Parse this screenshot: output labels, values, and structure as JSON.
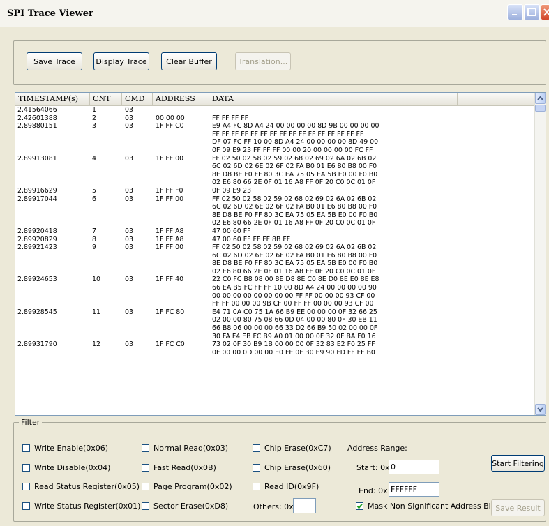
{
  "window": {
    "title": "SPI Trace Viewer"
  },
  "toolbar": {
    "save_trace": "Save Trace",
    "display_trace": "Display Trace",
    "clear_buffer": "Clear Buffer",
    "translation": "Translation..."
  },
  "columns": [
    "TIMESTAMP(s)",
    "CNT",
    "CMD",
    "ADDRESS",
    "DATA"
  ],
  "rows": [
    {
      "ts": "2.41564066",
      "cnt": "1",
      "cmd": "03",
      "addr": "",
      "data": [
        ""
      ]
    },
    {
      "ts": "2.42601388",
      "cnt": "2",
      "cmd": "03",
      "addr": "00 00 00",
      "data": [
        "FF FF FF FF"
      ]
    },
    {
      "ts": "2.89880151",
      "cnt": "3",
      "cmd": "03",
      "addr": "1F FF C0",
      "data": [
        "E9 A4 FC 8D A4 24 00 00 00 00 8D 9B 00 00 00 00",
        "FF FF FF FF FF FF FF FF FF FF FF FF FF FF FF FF",
        "DF 07 FC FF 10 00 8D A4 24 00 00 00 00 8D 49 00",
        "0F 09 E9 23 FF FF FF 00 00 20 00 00 00 00 FC FF"
      ]
    },
    {
      "ts": "2.89913081",
      "cnt": "4",
      "cmd": "03",
      "addr": "1F FF 00",
      "data": [
        "FF 02 50 02 58 02 59 02 68 02 69 02 6A 02 6B 02",
        "6C 02 6D 02 6E 02 6F 02 FA B0 01 E6 80 B8 00 F0",
        "8E D8 BE F0 FF 80 3C EA 75 05 EA 5B E0 00 F0 B0",
        "02 E6 80 66 2E 0F 01 16 A8 FF 0F 20 C0 0C 01 0F"
      ]
    },
    {
      "ts": "2.89916629",
      "cnt": "5",
      "cmd": "03",
      "addr": "1F FF F0",
      "data": [
        "0F 09 E9 23"
      ]
    },
    {
      "ts": "2.89917044",
      "cnt": "6",
      "cmd": "03",
      "addr": "1F FF 00",
      "data": [
        "FF 02 50 02 58 02 59 02 68 02 69 02 6A 02 6B 02",
        "6C 02 6D 02 6E 02 6F 02 FA B0 01 E6 80 B8 00 F0",
        "8E D8 BE F0 FF 80 3C EA 75 05 EA 5B E0 00 F0 B0",
        "02 E6 80 66 2E 0F 01 16 A8 FF 0F 20 C0 0C 01 0F"
      ]
    },
    {
      "ts": "2.89920418",
      "cnt": "7",
      "cmd": "03",
      "addr": "1F FF A8",
      "data": [
        "47 00 60 FF"
      ]
    },
    {
      "ts": "2.89920829",
      "cnt": "8",
      "cmd": "03",
      "addr": "1F FF A8",
      "data": [
        "47 00 60 FF FF FF 8B FF"
      ]
    },
    {
      "ts": "2.89921423",
      "cnt": "9",
      "cmd": "03",
      "addr": "1F FF 00",
      "data": [
        "FF 02 50 02 58 02 59 02 68 02 69 02 6A 02 6B 02",
        "6C 02 6D 02 6E 02 6F 02 FA B0 01 E6 80 B8 00 F0",
        "8E D8 BE F0 FF 80 3C EA 75 05 EA 5B E0 00 F0 B0",
        "02 E6 80 66 2E 0F 01 16 A8 FF 0F 20 C0 0C 01 0F"
      ]
    },
    {
      "ts": "2.89924653",
      "cnt": "10",
      "cmd": "03",
      "addr": "1F FF 40",
      "data": [
        "22 C0 FC B8 08 00 8E D8 8E C0 8E D0 8E E0 8E E8",
        "66 EA B5 FC FF FF 10 00 8D A4 24 00 00 00 00 90",
        "00 00 00 00 00 00 00 00 FF FF 00 00 00 93 CF 00",
        "FF FF 00 00 00 9B CF 00 FF FF 00 00 00 93 CF 00"
      ]
    },
    {
      "ts": "2.89928545",
      "cnt": "11",
      "cmd": "03",
      "addr": "1F FC 80",
      "data": [
        "E4 71 0A C0 75 1A 66 B9 EE 00 00 00 0F 32 66 25",
        "02 00 00 80 75 08 66 0D 04 00 00 80 0F 30 EB 11",
        "66 B8 06 00 00 00 66 33 D2 66 B9 50 02 00 00 0F",
        "30 FA F4 EB FC B9 A0 01 00 00 0F 32 0F BA F0 16"
      ]
    },
    {
      "ts": "2.89931790",
      "cnt": "12",
      "cmd": "03",
      "addr": "1F FC C0",
      "data": [
        "73 02 0F 30 B9 1B 00 00 00 0F 32 83 E2 F0 25 FF",
        "0F 00 00 0D 00 00 E0 FE 0F 30 E9 90 FD FF FF B0"
      ]
    }
  ],
  "filter": {
    "legend": "Filter",
    "col1": [
      "Write Enable(0x06)",
      "Write Disable(0x04)",
      "Read Status Register(0x05)",
      "Write Status Register(0x01)"
    ],
    "col2": [
      "Normal Read(0x03)",
      "Fast Read(0x0B)",
      "Page Program(0x02)",
      "Sector Erase(0xD8)"
    ],
    "col3": [
      "Chip Erase(0xC7)",
      "Chip Erase(0x60)",
      "Read ID(0x9F)"
    ],
    "others_label": "Others: 0x",
    "others_value": "",
    "address_range_label": "Address Range:",
    "start_label": "Start: 0x",
    "start_value": "0",
    "end_label": "End: 0x",
    "end_value": "FFFFFF",
    "mask_label": "Mask Non Significant Address Bits",
    "mask_checked": true,
    "start_filtering": "Start Filtering",
    "save_result": "Save Result"
  }
}
